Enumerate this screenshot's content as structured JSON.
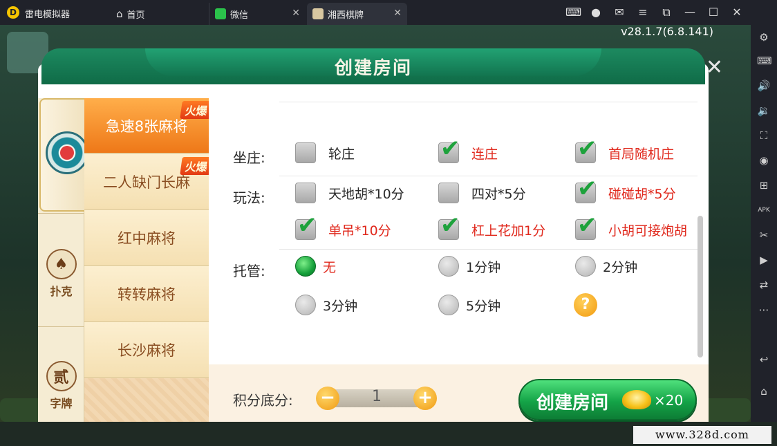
{
  "emulator": {
    "app_title": "雷电模拟器",
    "tabs": [
      {
        "label": "首页"
      },
      {
        "label": "微信"
      },
      {
        "label": "湘西棋牌"
      }
    ]
  },
  "game": {
    "version": "v28.1.7(6.8.141)",
    "dialog": {
      "title": "创建房间",
      "categories": [
        {
          "label": "",
          "icon": "mahjong-emblem-icon"
        },
        {
          "label": "扑克",
          "icon": "spade-icon"
        },
        {
          "label": "字牌",
          "icon": "tile-character-icon"
        }
      ],
      "hot_tag": "火爆",
      "games": [
        {
          "label": "急速8张麻将",
          "hot": true,
          "active": true
        },
        {
          "label": "二人缺门长麻",
          "hot": true,
          "active": false
        },
        {
          "label": "红中麻将",
          "hot": false,
          "active": false
        },
        {
          "label": "转转麻将",
          "hot": false,
          "active": false
        },
        {
          "label": "长沙麻将",
          "hot": false,
          "active": false
        }
      ],
      "options": {
        "dealer": {
          "label": "坐庄:",
          "items": [
            {
              "label": "轮庄",
              "checked": false
            },
            {
              "label": "连庄",
              "checked": true
            },
            {
              "label": "首局随机庄",
              "checked": true
            }
          ]
        },
        "rules": {
          "label": "玩法:",
          "items": [
            {
              "label": "天地胡*10分",
              "checked": false
            },
            {
              "label": "四对*5分",
              "checked": false
            },
            {
              "label": "碰碰胡*5分",
              "checked": true
            },
            {
              "label": "单吊*10分",
              "checked": true
            },
            {
              "label": "杠上花加1分",
              "checked": true
            },
            {
              "label": "小胡可接炮胡",
              "checked": true
            }
          ]
        },
        "auto": {
          "label": "托管:",
          "items": [
            {
              "label": "无",
              "selected": true
            },
            {
              "label": "1分钟",
              "selected": false
            },
            {
              "label": "2分钟",
              "selected": false
            },
            {
              "label": "3分钟",
              "selected": false
            },
            {
              "label": "5分钟",
              "selected": false
            }
          ],
          "help": "?"
        }
      },
      "score": {
        "label": "积分底分:",
        "value": "1",
        "minus": "−",
        "plus": "+"
      },
      "create_button": {
        "label": "创建房间",
        "cost": "×20"
      },
      "close": "✕"
    }
  },
  "watermark": "www.328d.com",
  "colors": {
    "accent_green": "#14a347",
    "active_orange": "#ee7818",
    "red_text": "#e0281c"
  }
}
